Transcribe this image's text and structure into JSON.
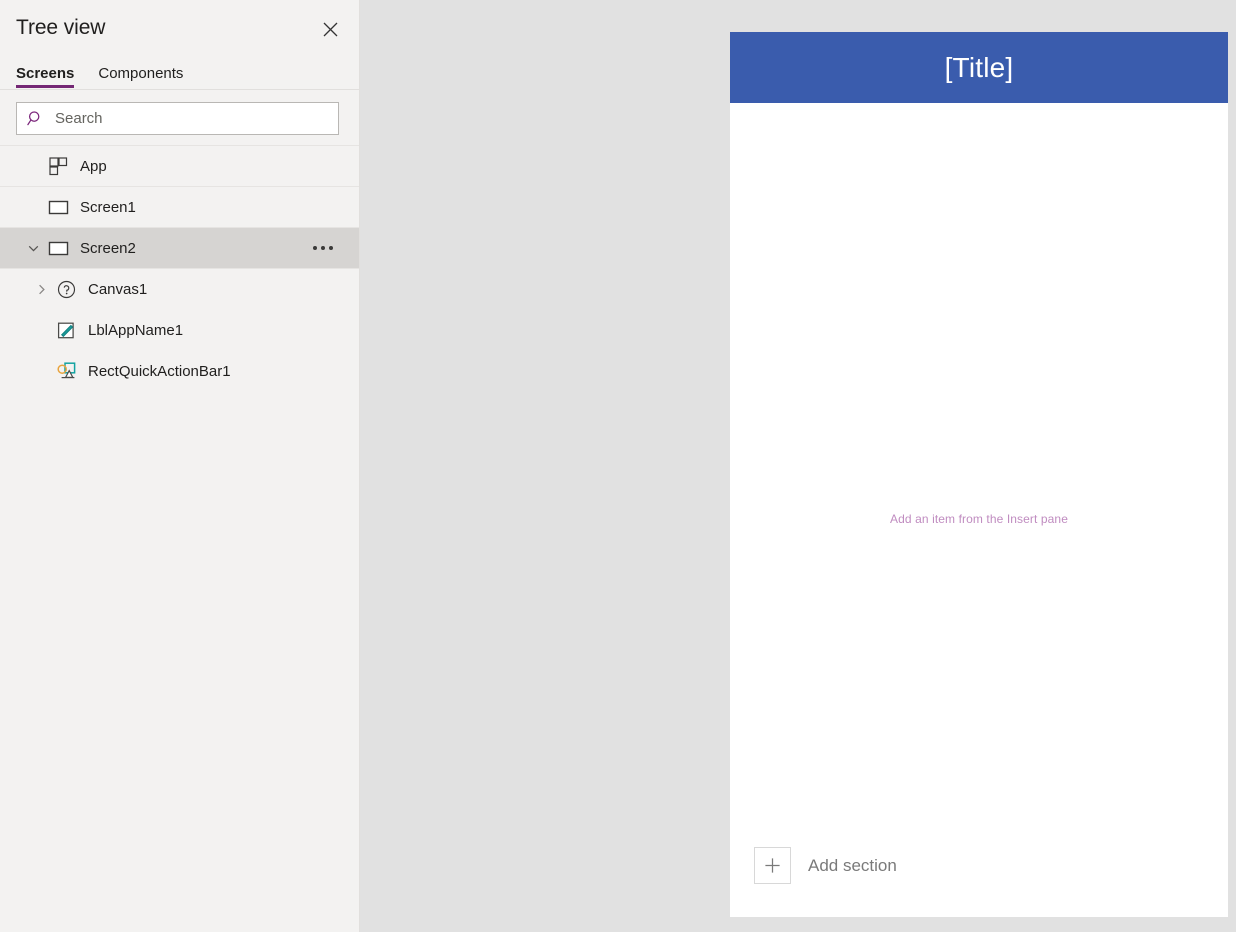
{
  "panel": {
    "title": "Tree view",
    "close_icon": "close-icon",
    "tabs": [
      {
        "label": "Screens",
        "active": true
      },
      {
        "label": "Components",
        "active": false
      }
    ],
    "search": {
      "placeholder": "Search",
      "value": "",
      "icon": "search-icon"
    },
    "tree": [
      {
        "label": "App",
        "icon": "app-grid-icon",
        "indent": 0,
        "twisty": "none",
        "selected": false,
        "more": false
      },
      {
        "label": "Screen1",
        "icon": "screen-rectangle-icon",
        "indent": 1,
        "twisty": "none",
        "selected": false,
        "more": false
      },
      {
        "label": "Screen2",
        "icon": "screen-rectangle-icon",
        "indent": 1,
        "twisty": "expanded",
        "selected": true,
        "more": true
      },
      {
        "label": "Canvas1",
        "icon": "question-circle-icon",
        "indent": 2,
        "twisty": "collapsed",
        "selected": false,
        "more": false
      },
      {
        "label": "LblAppName1",
        "icon": "label-pencil-icon",
        "indent": 2,
        "twisty": "none",
        "selected": false,
        "more": false
      },
      {
        "label": "RectQuickActionBar1",
        "icon": "shapes-icon",
        "indent": 2,
        "twisty": "none",
        "selected": false,
        "more": false
      }
    ]
  },
  "canvas": {
    "screen": {
      "title_text": "[Title]",
      "title_bar_color": "#3a5cad",
      "hint_text": "Add an item from the Insert pane",
      "hint_color": "#c08cc0",
      "add_section": {
        "label": "Add section",
        "icon": "plus-icon"
      }
    }
  },
  "colors": {
    "accent_purple": "#742774",
    "panel_background": "#f3f2f1",
    "canvas_background": "#e1e1e1",
    "selected_row": "#d6d4d2"
  }
}
